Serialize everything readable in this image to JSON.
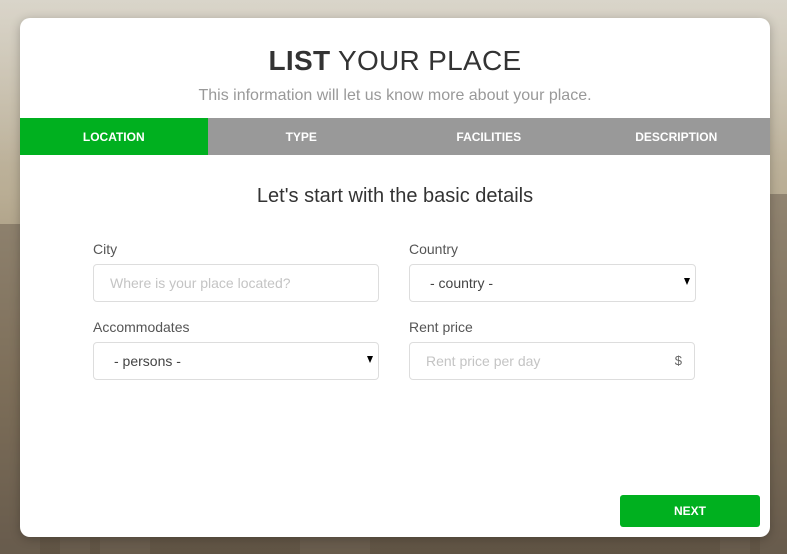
{
  "header": {
    "title_bold": "LIST",
    "title_rest": "YOUR PLACE",
    "subtitle": "This information will let us know more about your place."
  },
  "tabs": [
    {
      "label": "LOCATION",
      "active": true
    },
    {
      "label": "TYPE",
      "active": false
    },
    {
      "label": "FACILITIES",
      "active": false
    },
    {
      "label": "DESCRIPTION",
      "active": false
    }
  ],
  "section_title": "Let's start with the basic details",
  "form": {
    "city": {
      "label": "City",
      "placeholder": "Where is your place located?",
      "value": ""
    },
    "country": {
      "label": "Country",
      "selected": "- country -"
    },
    "accommodates": {
      "label": "Accommodates",
      "selected": "- persons -"
    },
    "rent_price": {
      "label": "Rent price",
      "placeholder": "Rent price per day",
      "value": "",
      "addon": "$"
    }
  },
  "actions": {
    "next_label": "NEXT"
  },
  "colors": {
    "accent": "#00b01f",
    "tab_bar": "#999999"
  }
}
